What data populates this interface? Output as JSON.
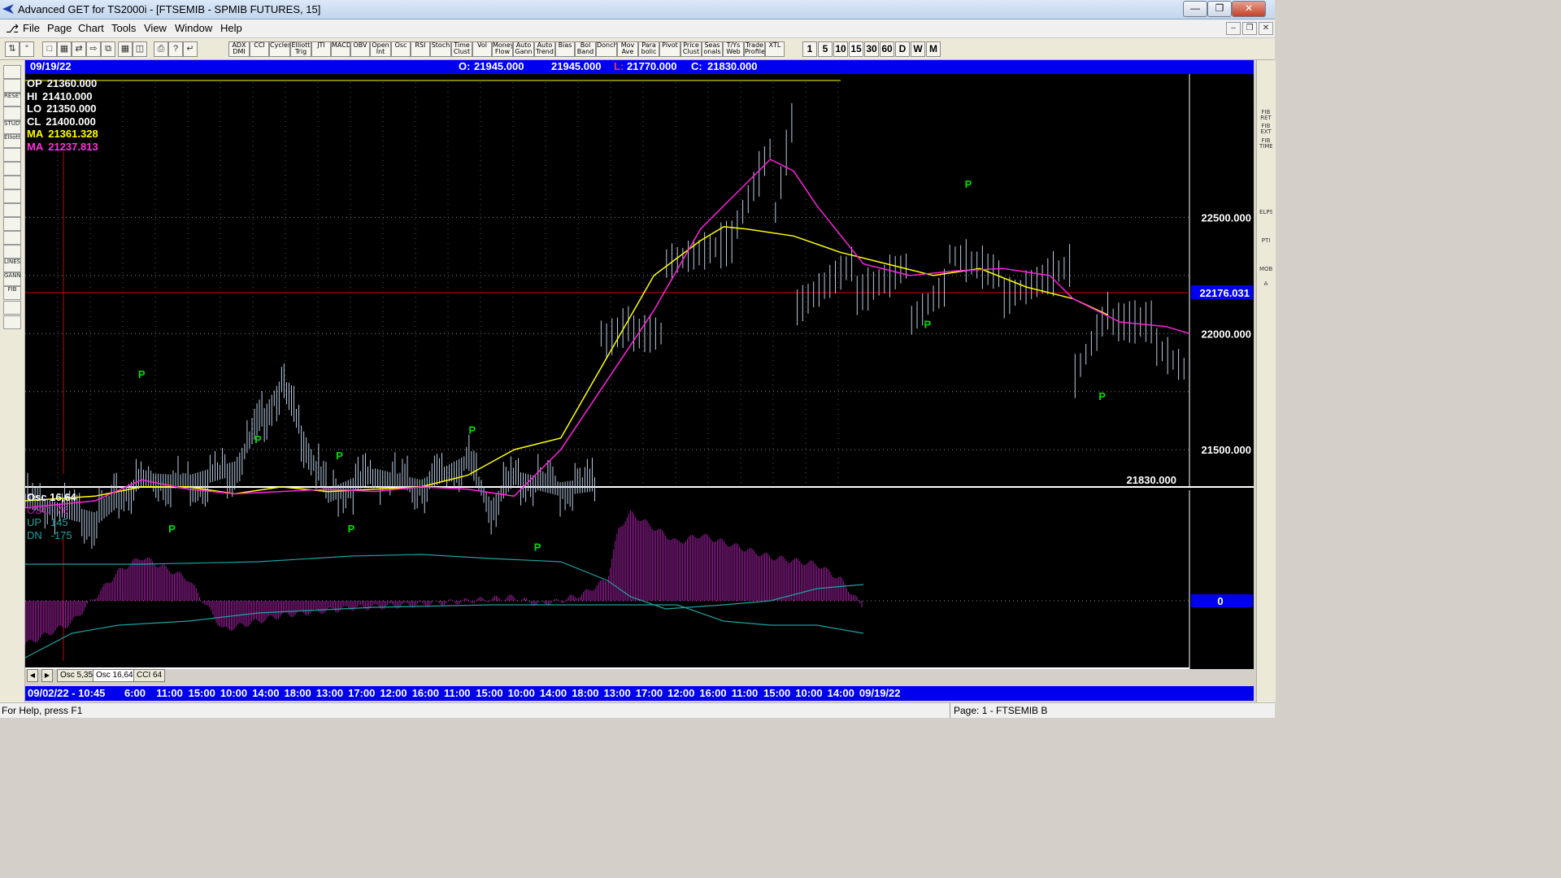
{
  "window": {
    "title": "Advanced GET for TS2000i - [FTSEMIB - SPMIB FUTURES, 15]"
  },
  "menu": [
    "File",
    "Page",
    "Chart",
    "Tools",
    "View",
    "Window",
    "Help"
  ],
  "toolbar": {
    "studies": [
      "ADX DMI",
      "CCI",
      "Cycles",
      "Elliott Trig",
      "JTI",
      "MACD",
      "OBV",
      "Open Int",
      "Osc",
      "RSI",
      "Stoch",
      "Time Clust",
      "Vol",
      "Money Flow",
      "Auto Gann",
      "Auto Trend",
      "Bias",
      "Bol Band",
      "Donch",
      "Mov Ave",
      "Para bolic",
      "Pivot",
      "Price Clust",
      "Seas onals",
      "T/Ys Web",
      "Trade Profile",
      "XTL"
    ],
    "intervals": [
      "1",
      "5",
      "10",
      "15",
      "30",
      "60",
      "D",
      "W",
      "M"
    ]
  },
  "left_tools": [
    "",
    "",
    "RESET",
    "",
    "STUDY",
    "Elliott",
    "",
    "",
    "",
    "",
    "",
    "",
    "",
    "",
    "LINES",
    "GANN",
    "FIB",
    "",
    ""
  ],
  "right_tools": [
    "",
    "",
    "",
    "FIB RET",
    "FIB EXT",
    "FIB TIME",
    "",
    "",
    "",
    "",
    "ELPS",
    "",
    "PTI",
    "",
    "MOB",
    "A",
    "",
    "",
    "",
    "",
    ""
  ],
  "header": {
    "date": "09/19/22",
    "open_label": "O:",
    "open_value": "21945.000",
    "high_value": "21945.000",
    "low_label": "L:",
    "low_value": "21770.000",
    "close_label": "C:",
    "close_value": "21830.000"
  },
  "legend": [
    {
      "label": "OP",
      "value": "21360.000",
      "color": "#ffffff"
    },
    {
      "label": "HI",
      "value": "21410.000",
      "color": "#ffffff"
    },
    {
      "label": "LO",
      "value": "21350.000",
      "color": "#ffffff"
    },
    {
      "label": "CL",
      "value": "21400.000",
      "color": "#ffffff"
    },
    {
      "label": "MA",
      "value": "21361.328",
      "color": "#ffff00"
    },
    {
      "label": "MA",
      "value": "21237.813",
      "color": "#ff33dd"
    }
  ],
  "price_axis": {
    "ticks": [
      {
        "value": 22500,
        "label": "22500.000"
      },
      {
        "value": 22000,
        "label": "22000.000"
      },
      {
        "value": 21500,
        "label": "21500.000"
      }
    ],
    "cursor_value": 22176.031,
    "cursor_label": "22176.031",
    "last_label": "21830.000"
  },
  "osc_panel": {
    "title": "Osc 16,64",
    "osc_label": "OSC",
    "osc_value": "-76",
    "up_label": "UP",
    "up_value": "145",
    "dn_label": "DN",
    "dn_value": "-175",
    "zero_label": "0"
  },
  "tabs": [
    "Osc 5,35",
    "Osc 16,64",
    "CCI 64"
  ],
  "time_axis": [
    "09/02/22 - 10:45",
    "6:00",
    "11:00",
    "15:00",
    "10:00",
    "14:00",
    "18:00",
    "13:00",
    "17:00",
    "12:00",
    "16:00",
    "11:00",
    "15:00",
    "10:00",
    "14:00",
    "18:00",
    "13:00",
    "17:00",
    "12:00",
    "16:00",
    "11:00",
    "15:00",
    "10:00",
    "14:00",
    "09/19/22"
  ],
  "status": {
    "help": "For Help, press F1",
    "page": "Page: 1 - FTSEMIB B"
  },
  "colors": {
    "bg": "#000000",
    "bars": "#b8cce4",
    "ma_fast": "#ffff00",
    "ma_slow": "#ff22dd",
    "pivot": "#00dd00",
    "osc_hist": "#a020a0",
    "band": "#20a0a0",
    "cursor": "#cc0000",
    "blue": "#0000ee"
  },
  "chart_data": {
    "type": "line",
    "title": "FTSEMIB - SPMIB FUTURES, 15",
    "ylim": [
      21350,
      23100
    ],
    "series": [
      {
        "name": "CL",
        "x_pos": [
          0,
          6,
          10,
          14,
          18,
          22,
          26,
          30,
          34,
          38,
          40,
          42,
          46,
          50,
          54,
          58,
          60,
          62,
          66,
          70,
          74,
          77,
          80,
          84,
          88,
          92,
          100
        ],
        "values": [
          21280,
          21200,
          21370,
          21360,
          21420,
          21780,
          21300,
          21390,
          21340,
          21450,
          21250,
          21380,
          21330,
          21360,
          21400,
          21340,
          21500,
          21380,
          21330,
          21350,
          21290,
          21200,
          21400,
          21500,
          21900,
          22000,
          21980
        ]
      },
      {
        "name": "MA",
        "x_pos": [
          0,
          6,
          10,
          14,
          18,
          22,
          26,
          30,
          34,
          38,
          42,
          46,
          50,
          54,
          58,
          60,
          62
        ],
        "values": [
          21280,
          21300,
          21340,
          21340,
          21310,
          21340,
          21320,
          21330,
          21340,
          21390,
          21500,
          21550,
          21900,
          22250,
          22400,
          22460,
          22450
        ]
      },
      {
        "name": "MA",
        "x_pos": [
          0,
          6,
          10,
          14,
          18,
          22,
          26,
          30,
          34,
          38,
          42,
          46,
          50,
          54,
          58,
          60,
          62
        ],
        "values": [
          21250,
          21280,
          21370,
          21330,
          21310,
          21320,
          21330,
          21320,
          21340,
          21330,
          21300,
          21500,
          21800,
          22100,
          22450,
          22550,
          22650
        ]
      }
    ],
    "pivots": [
      {
        "x_pos": 10,
        "value": 21780,
        "position": "above"
      },
      {
        "x_pos": 12.6,
        "value": 21200,
        "position": "below"
      },
      {
        "x_pos": 20,
        "value": 21500,
        "position": "above"
      },
      {
        "x_pos": 27,
        "value": 21430,
        "position": "above"
      },
      {
        "x_pos": 28,
        "value": 21200,
        "position": "below"
      },
      {
        "x_pos": 38.4,
        "value": 21540,
        "position": "above"
      },
      {
        "x_pos": 44,
        "value": 21120,
        "position": "below"
      },
      {
        "x_pos": 77.5,
        "value": 22080,
        "position": "below"
      },
      {
        "x_pos": 81,
        "value": 22600,
        "position": "above"
      },
      {
        "x_pos": 92.5,
        "value": 21770,
        "position": "below"
      }
    ]
  }
}
